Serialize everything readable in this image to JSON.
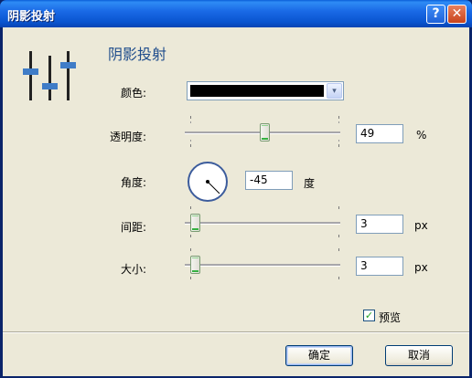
{
  "window": {
    "title": "阴影投射"
  },
  "titlebar": {
    "help_glyph": "?",
    "close_glyph": "✕"
  },
  "panel": {
    "heading": "阴影投射"
  },
  "color": {
    "label": "颜色:",
    "value": "#000000",
    "dropdown_glyph": "▾"
  },
  "opacity": {
    "label": "透明度:",
    "value": "49",
    "unit": "%",
    "slider_fraction": 0.49
  },
  "angle": {
    "label": "角度:",
    "value": "-45",
    "unit": "度"
  },
  "distance": {
    "label": "间距:",
    "value": "3",
    "unit": "px"
  },
  "size": {
    "label": "大小:",
    "value": "3",
    "unit": "px"
  },
  "preview": {
    "label": "预览",
    "checked": true
  },
  "buttons": {
    "ok": "确定",
    "cancel": "取消"
  },
  "colors": {
    "titlebar": "#0a5fd8",
    "dialog_bg": "#ece9d8",
    "heading": "#1f4d8c",
    "dial_ring": "#3c5c9c"
  }
}
